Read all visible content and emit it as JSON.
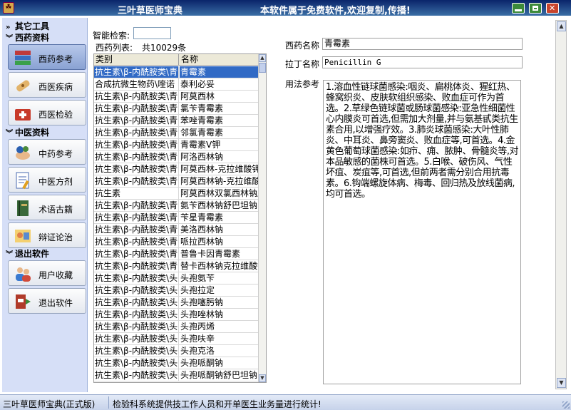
{
  "titlebar": {
    "title": "三叶草医师宝典",
    "notice": "本软件属于免费软件,欢迎复制,传播!"
  },
  "sidebar": {
    "sections": [
      {
        "label": "其它工具",
        "icon": "chevron-double-right-icon"
      },
      {
        "label": "西药资料",
        "icon": "chevron-double-down-icon"
      },
      {
        "label": "中医资料",
        "icon": "chevron-double-down-icon"
      },
      {
        "label": "退出软件",
        "icon": "chevron-double-down-icon"
      }
    ],
    "buttons": [
      {
        "label": "西药参考",
        "icon": "books-icon",
        "active": true
      },
      {
        "label": "西医疾病",
        "icon": "bandage-icon"
      },
      {
        "label": "西医检验",
        "icon": "medical-kit-icon"
      },
      {
        "label": "中药参考",
        "icon": "herb-hand-icon"
      },
      {
        "label": "中医方剂",
        "icon": "prescription-icon"
      },
      {
        "label": "术语古籍",
        "icon": "book-icon"
      },
      {
        "label": "辩证论治",
        "icon": "discussion-icon"
      },
      {
        "label": "用户收藏",
        "icon": "users-icon"
      },
      {
        "label": "退出软件",
        "icon": "exit-icon"
      }
    ]
  },
  "search": {
    "label": "智能检索:",
    "value": ""
  },
  "list": {
    "label": "西药列表:",
    "count": "共10029条",
    "headers": [
      "类别",
      "名称"
    ],
    "rows": [
      [
        "抗生素\\β-内酰胺类\\青",
        "青霉素"
      ],
      [
        "合成抗微生物药\\喹诺",
        "泰利必妥"
      ],
      [
        "抗生素\\β-内酰胺类\\青",
        "阿莫西林"
      ],
      [
        "抗生素\\β-内酰胺类\\青",
        "氯苄青霉素"
      ],
      [
        "抗生素\\β-内酰胺类\\青",
        "苯唑青霉素"
      ],
      [
        "抗生素\\β-内酰胺类\\青",
        "邻氯青霉素"
      ],
      [
        "抗生素\\β-内酰胺类\\青",
        "青霉素V钾"
      ],
      [
        "抗生素\\β-内酰胺类\\青",
        "阿洛西林钠"
      ],
      [
        "抗生素\\β-内酰胺类\\青",
        "阿莫西林-克拉维酸钾"
      ],
      [
        "抗生素\\β-内酰胺类\\青",
        "阿莫西林钠-克拉维酸钾"
      ],
      [
        "抗生素",
        "阿莫西林双氯西林钠胶"
      ],
      [
        "抗生素\\β-内酰胺类\\青",
        "氨苄西林钠舒巴坦钠"
      ],
      [
        "抗生素\\β-内酰胺类\\青",
        "苄星青霉素"
      ],
      [
        "抗生素\\β-内酰胺类\\青",
        "美洛西林钠"
      ],
      [
        "抗生素\\β-内酰胺类\\青",
        "哌拉西林钠"
      ],
      [
        "抗生素\\β-内酰胺类\\青",
        "普鲁卡因青霉素"
      ],
      [
        "抗生素\\β-内酰胺类\\青",
        "替卡西林钠克拉维酸钾"
      ],
      [
        "抗生素\\β-内酰胺类\\头",
        "头孢氨苄"
      ],
      [
        "抗生素\\β-内酰胺类\\头",
        "头孢拉定"
      ],
      [
        "抗生素\\β-内酰胺类\\头",
        "头孢噻肟钠"
      ],
      [
        "抗生素\\β-内酰胺类\\头",
        "头孢唑林钠"
      ],
      [
        "抗生素\\β-内酰胺类\\头",
        "头孢丙烯"
      ],
      [
        "抗生素\\β-内酰胺类\\头",
        "头孢呋辛"
      ],
      [
        "抗生素\\β-内酰胺类\\头",
        "头孢克洛"
      ],
      [
        "抗生素\\β-内酰胺类\\头",
        "头孢哌酮钠"
      ],
      [
        "抗生素\\β-内酰胺类\\头",
        "头孢哌酮钠舒巴坦钠"
      ]
    ],
    "selected_index": 0
  },
  "detail": {
    "name_label": "西药名称",
    "name_value": "青霉素",
    "latin_label": "拉丁名称",
    "latin_value": "Penicillin G",
    "usage_label": "用法参考",
    "usage_value": "1.溶血性链球菌感染:咽炎、扁桃体炎、猩红热、蜂窝织炎、皮肤软组织感染、败血症可作为首选。2.草绿色链球菌或肠球菌感染:亚急性细菌性心内膜炎可首选,但需加大剂量,并与氨基甙类抗生素合用,以增强疗效。3.肺炎球菌感染:大叶性肺炎、中耳炎、鼻旁窦炎、败血症等,可首选。4.金黄色葡萄球菌感染:如疖、痈、脓肿、骨髓炎等,对本品敏感的菌株可首选。5.白喉、破伤风、气性坏疽、炭疽等,可首选,但前两者需分别合用抗毒素。6.钩端螺旋体病、梅毒、回归热及放线菌病,均可首选。"
  },
  "status": {
    "left": "三叶草医师宝典(正式版)",
    "right": "检验科系统提供技工作人员和开单医生业务量进行统计!"
  },
  "colors": {
    "titlebar": "#0a246a",
    "sidebar": "#d6dff7",
    "selection": "#316ac5"
  }
}
